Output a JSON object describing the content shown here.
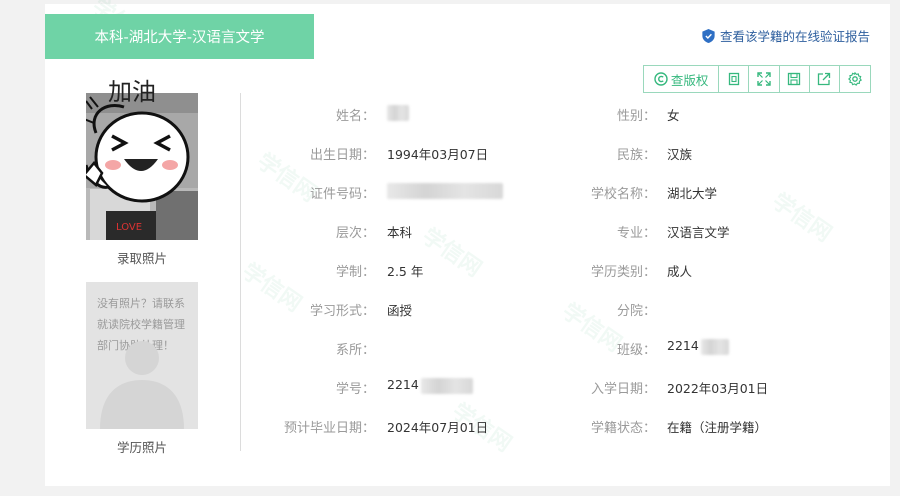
{
  "header": {
    "title": "本科-湖北大学-汉语言文学"
  },
  "verify_link": {
    "label": "查看该学籍的在线验证报告"
  },
  "toolbar": {
    "check_copyright_label": "查版权",
    "icons": [
      "copy-icon",
      "fullscreen-icon",
      "save-icon",
      "share-icon",
      "settings-icon"
    ]
  },
  "photos": {
    "admission": {
      "caption": "录取照片",
      "sticker_text": "加油"
    },
    "diploma": {
      "caption": "学历照片",
      "placeholder_lines": [
        "没有照片？请联系",
        "就读院校学籍管理",
        "部门协助处理！"
      ]
    }
  },
  "fields_left": [
    {
      "label": "姓名：",
      "value": ""
    },
    {
      "label": "出生日期：",
      "value": "1994年03月07日"
    },
    {
      "label": "证件号码：",
      "value": ""
    },
    {
      "label": "层次：",
      "value": "本科"
    },
    {
      "label": "学制：",
      "value": "2.5 年"
    },
    {
      "label": "学习形式：",
      "value": "函授"
    },
    {
      "label": "系所：",
      "value": ""
    },
    {
      "label": "学号：",
      "value": "2214"
    },
    {
      "label": "预计毕业日期：",
      "value": "2024年07月01日"
    }
  ],
  "fields_right": [
    {
      "label": "性别：",
      "value": "女"
    },
    {
      "label": "民族：",
      "value": "汉族"
    },
    {
      "label": "学校名称：",
      "value": "湖北大学"
    },
    {
      "label": "专业：",
      "value": "汉语言文学"
    },
    {
      "label": "学历类别：",
      "value": "成人"
    },
    {
      "label": "分院：",
      "value": ""
    },
    {
      "label": "班级：",
      "value": "2214"
    },
    {
      "label": "入学日期：",
      "value": "2022年03月01日"
    },
    {
      "label": "学籍状态：",
      "value": "在籍（注册学籍）"
    }
  ],
  "watermark_text": "学信网",
  "colors": {
    "accent": "#6fd3a6",
    "toolbar_green": "#36b87e",
    "link_blue": "#2e5f9e"
  }
}
